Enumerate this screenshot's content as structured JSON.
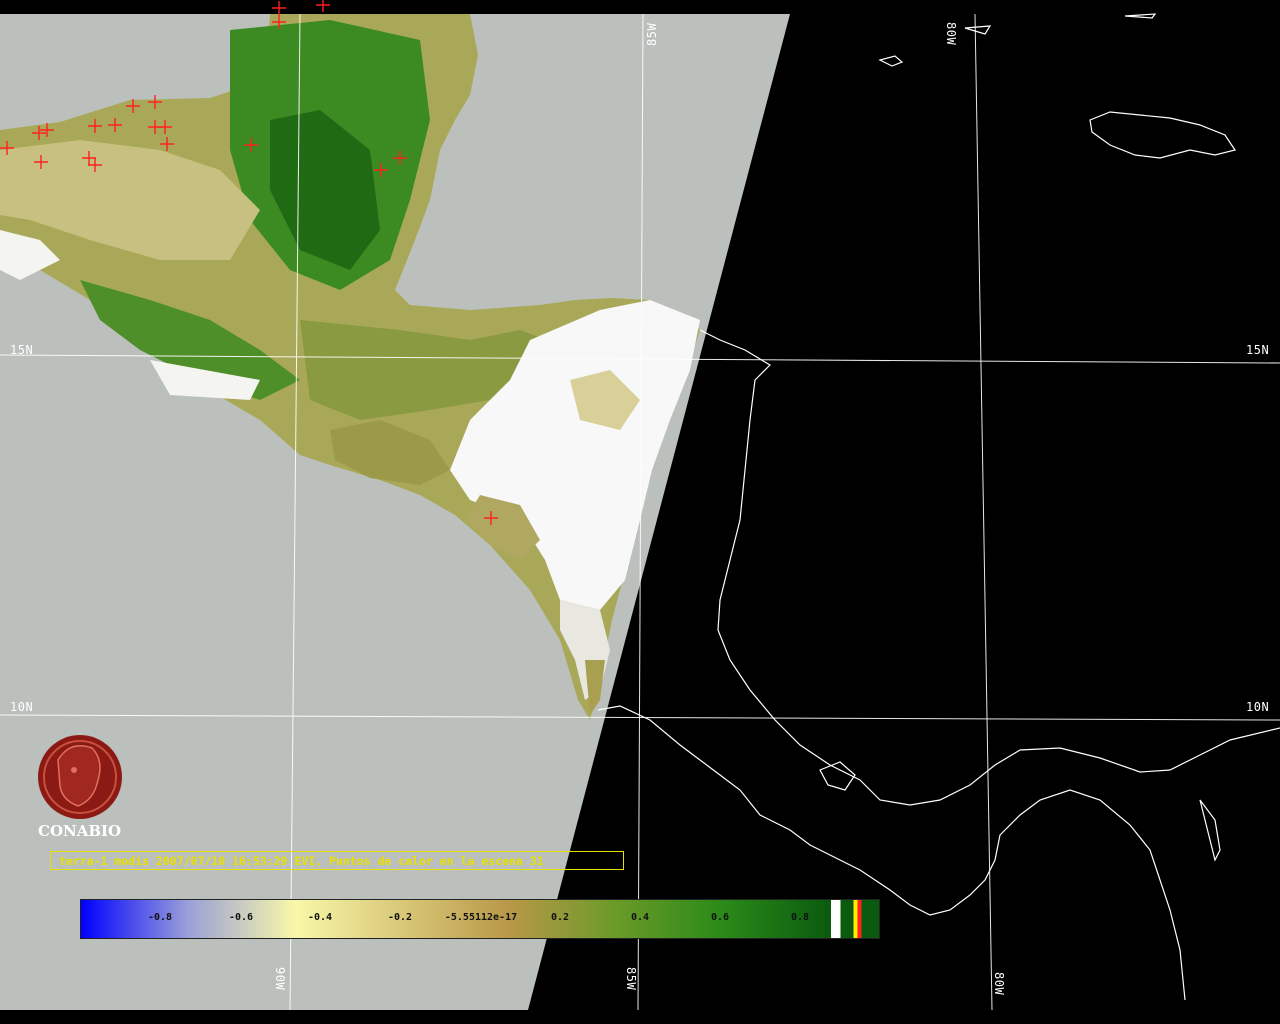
{
  "title": "terra-1 modis 2007/07/10 16:53:29 EVI, Puntos de calor en la escena 31",
  "logo": {
    "text": "CONABIO",
    "icon": "conabio-macaw-logo-icon",
    "color": "#8b1a14"
  },
  "grid_labels": {
    "lat_15_left": "15N",
    "lat_15_right": "15N",
    "lat_10_left": "10N",
    "lat_10_right": "10N",
    "lon_85_top": "85W",
    "lon_80_top": "80W",
    "lon_90_bottom": "90W",
    "lon_85_bottom": "85W",
    "lon_80_bottom": "80W"
  },
  "colorbar": {
    "ticks": [
      "-0.8",
      "-0.6",
      "-0.4",
      "-0.2",
      "-5.55112e-17",
      "0.2",
      "0.4",
      "0.6",
      "0.8"
    ],
    "colors": [
      "#0000ff",
      "#9aa0d8",
      "#f8f8a8",
      "#d8c878",
      "#b89848",
      "#6a9a28",
      "#2a8a18",
      "#0a5a10"
    ]
  },
  "colors": {
    "swath_bg": "#bcc0bc",
    "night": "#000000",
    "coastline": "#ffffff",
    "grid": "#ffffff",
    "hotspot": "#ff2020",
    "caption": "#e8e000"
  }
}
